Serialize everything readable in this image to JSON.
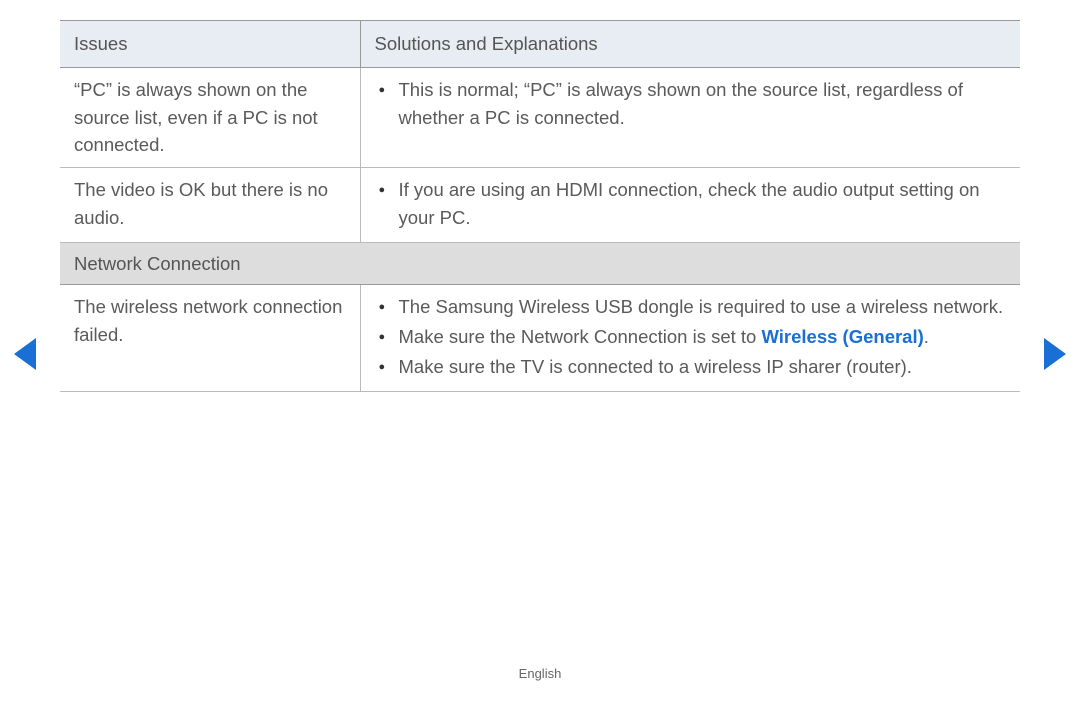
{
  "headers": {
    "issues": "Issues",
    "solutions": "Solutions and Explanations"
  },
  "rows": [
    {
      "issue": "“PC” is always shown on the source list, even if a PC is not connected.",
      "solutions": [
        "This is normal; “PC” is always shown on the source list, regardless of whether a PC is connected."
      ]
    },
    {
      "issue": "The video is OK but there is no audio.",
      "solutions": [
        "If you are using an HDMI connection, check the audio output setting on your PC."
      ]
    }
  ],
  "section": {
    "title": "Network Connection"
  },
  "network_row": {
    "issue": "The wireless network connection failed.",
    "solutions": {
      "s1": "The Samsung Wireless USB dongle is required to use a wireless network.",
      "s2_prefix": "Make sure the Network Connection is set to ",
      "s2_link": "Wireless (General)",
      "s2_suffix": ".",
      "s3": "Make sure the TV is connected to a wireless IP sharer (router)."
    }
  },
  "footer": "English"
}
